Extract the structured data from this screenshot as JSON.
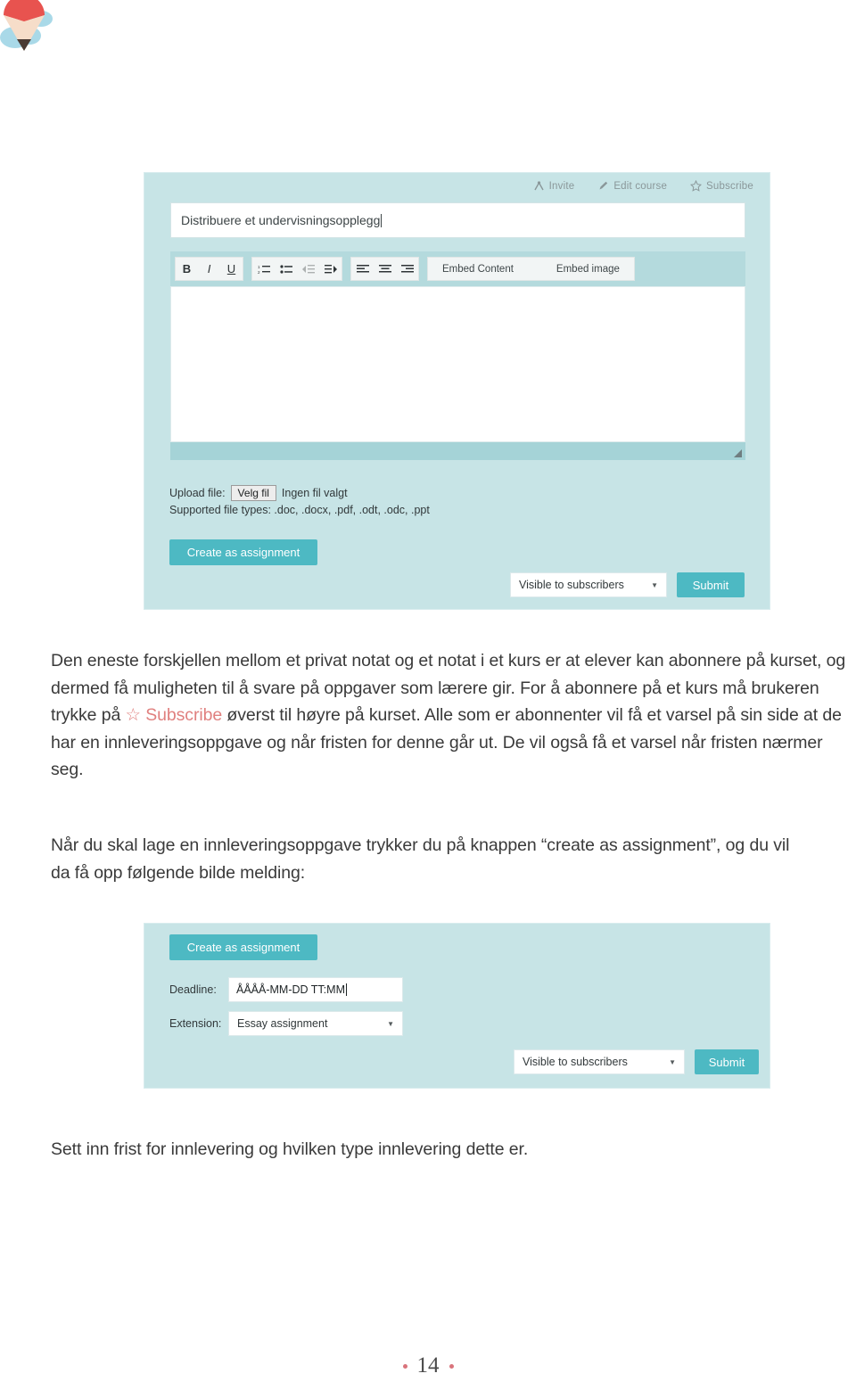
{
  "brand": {
    "logo_name": "pencil-balloon-logo",
    "logo_red": "#e8534f",
    "logo_body": "#f6ddc9",
    "logo_tip": "#4a3b34",
    "cloud_color": "#a9d9e8"
  },
  "colors": {
    "panel_background": "#c7e4e6",
    "toolbar_background": "#b4dadd",
    "accent_teal": "#4db9c3",
    "subscribe_pink": "#e0807f",
    "body_text": "#3a3a3a",
    "page_dot": "#d9737b"
  },
  "screenshot1": {
    "name": "note-editor-screenshot",
    "topbar": [
      {
        "icon": "person-invite-icon",
        "label": "Invite"
      },
      {
        "icon": "pencil-edit-icon",
        "label": "Edit course"
      },
      {
        "icon": "star-subscribe-icon",
        "label": "Subscribe"
      }
    ],
    "title_value": "Distribuere et undervisningsopplegg",
    "toolbar": {
      "text_buttons": [
        {
          "icon": "bold-icon",
          "label": "B"
        },
        {
          "icon": "italic-icon",
          "label": "I"
        },
        {
          "icon": "underline-icon",
          "label": "U"
        }
      ],
      "list_buttons": [
        {
          "icon": "ordered-list-icon",
          "label": "1."
        },
        {
          "icon": "unordered-list-icon",
          "label": "•"
        },
        {
          "icon": "outdent-icon",
          "label": "⇤"
        },
        {
          "icon": "indent-icon",
          "label": "⇥"
        }
      ],
      "align_buttons": [
        {
          "icon": "align-left-icon",
          "label": "≡"
        },
        {
          "icon": "align-center-icon",
          "label": "≡"
        },
        {
          "icon": "align-right-icon",
          "label": "≡"
        }
      ],
      "embed_content_label": "Embed Content",
      "embed_image_label": "Embed image"
    },
    "editor_body_text": "",
    "upload_label": "Upload file:",
    "choose_file_label": "Velg fil",
    "no_file_label": "Ingen fil valgt",
    "supported_types": "Supported file types: .doc, .docx, .pdf, .odt, .odc, .ppt",
    "create_assignment_label": "Create as assignment",
    "visibility_value": "Visible to subscribers",
    "submit_label": "Submit"
  },
  "screenshot2": {
    "name": "create-assignment-screenshot",
    "create_assignment_label": "Create as assignment",
    "deadline_label": "Deadline:",
    "deadline_value": "ÅÅÅÅ-MM-DD TT:MM",
    "extension_label": "Extension:",
    "extension_value": "Essay assignment",
    "visibility_value": "Visible to subscribers",
    "submit_label": "Submit"
  },
  "body": {
    "paragraph1_part1": "Den eneste forskjellen mellom et privat notat og et notat i et kurs er at elever kan abonnere på kurset, og dermed få muligheten til å svare på oppgaver som lærere gir. For å abonnere på et kurs må brukeren trykke på ",
    "paragraph1_subscribe": "☆ Subscribe",
    "paragraph1_part2": " øverst til høyre på kurset. Alle som er abonnenter vil få et varsel på sin side at de har en innleveringsoppgave og når fristen for denne går ut. De vil også få et varsel når fristen nærmer seg.",
    "paragraph2": "Når du skal lage en innleveringsoppgave trykker du på knappen “create as assignment”, og du vil da få opp følgende bilde melding:",
    "caption": "Sett inn frist for innlevering og hvilken type innlevering dette er."
  },
  "footer": {
    "page_number": "14"
  }
}
